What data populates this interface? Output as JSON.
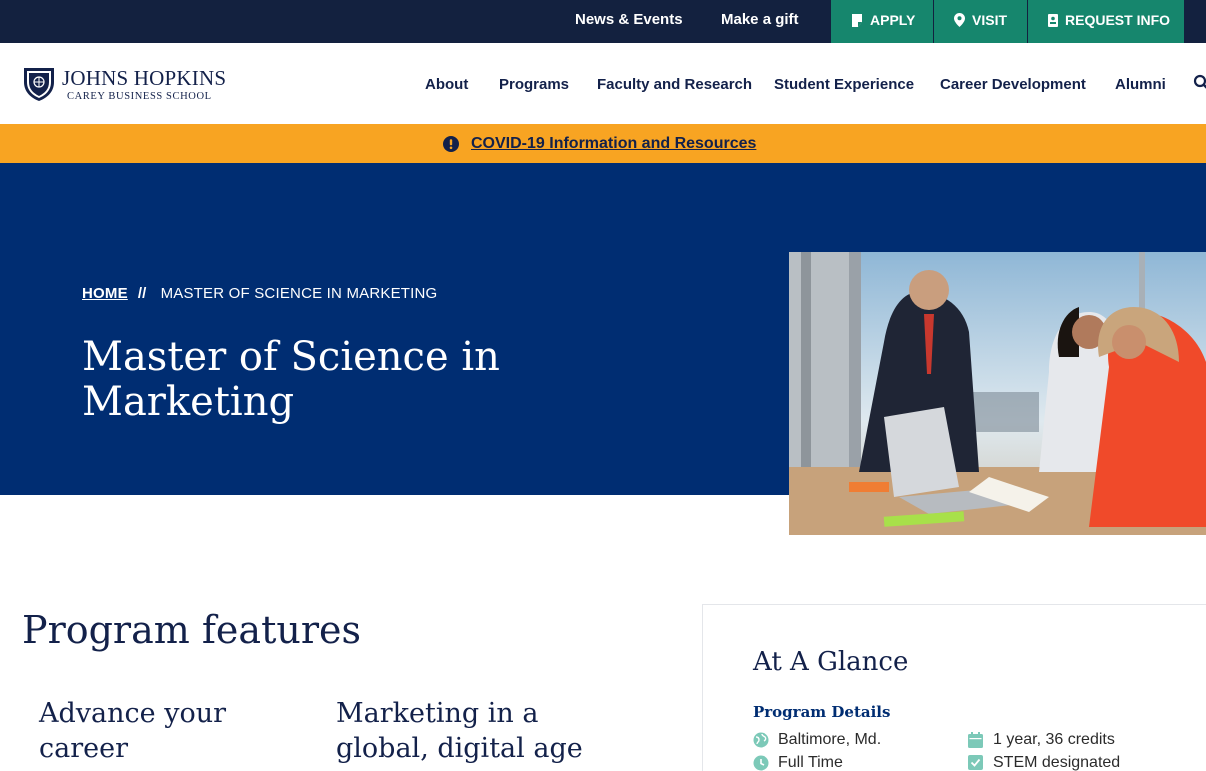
{
  "utility": {
    "links": [
      "News & Events",
      "Make a gift"
    ],
    "apply": "APPLY",
    "visit": "VISIT",
    "request_info": "REQUEST INFO"
  },
  "logo": {
    "name": "JOHNS HOPKINS",
    "subtitle": "CAREY BUSINESS SCHOOL"
  },
  "nav": {
    "items": [
      "About",
      "Programs",
      "Faculty and Research",
      "Student Experience",
      "Career Development",
      "Alumni"
    ]
  },
  "alert": {
    "text": "COVID-19 Information and Resources"
  },
  "hero": {
    "breadcrumb_home": "HOME",
    "breadcrumb_sep": "//",
    "breadcrumb_current": "MASTER OF SCIENCE IN MARKETING",
    "title": "Master of Science in Marketing"
  },
  "features": {
    "heading": "Program features",
    "items": [
      "Advance your career",
      "Marketing in a global, digital age"
    ]
  },
  "glance": {
    "title": "At A Glance",
    "subtitle": "Program Details",
    "details": [
      "Baltimore, Md.",
      "Full Time",
      "1 year, 36 credits",
      "STEM designated"
    ]
  },
  "colors": {
    "utility_bg": "#13213f",
    "cta_green": "#16866d",
    "alert_orange": "#f8a422",
    "hero_blue": "#002d72",
    "text_navy": "#13214a"
  }
}
